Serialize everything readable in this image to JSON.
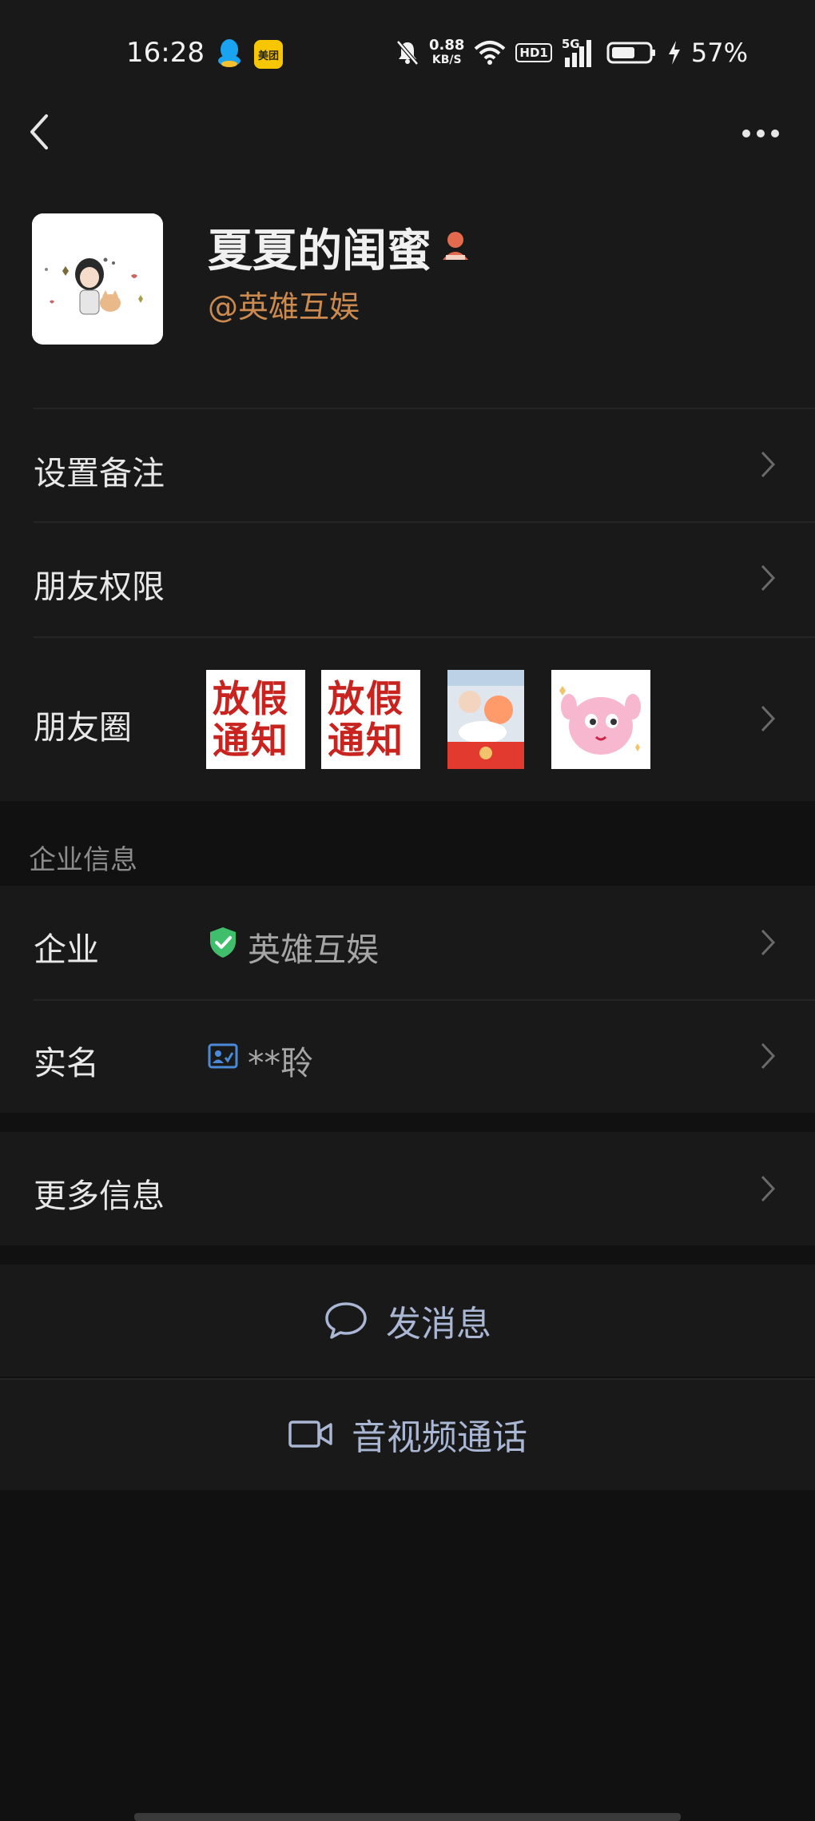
{
  "status_bar": {
    "time": "16:28",
    "net_speed_value": "0.88",
    "net_speed_unit": "KB/S",
    "hd_label": "HD1",
    "signal_label": "5G",
    "battery_percent": "57%",
    "icons": [
      "qq-icon",
      "meituan-icon",
      "mute-bell-icon",
      "wifi-icon",
      "signal-icon",
      "battery-icon",
      "charging-icon"
    ],
    "meituan_label": "美团"
  },
  "nav": {
    "back_icon": "chevron-left-icon",
    "more_icon": "more-horizontal-icon"
  },
  "profile": {
    "name": "夏夏的闺蜜",
    "badge_icon": "person-badge-icon",
    "company_tag": "@英雄互娱"
  },
  "rows": {
    "remark": {
      "label": "设置备注"
    },
    "permissions": {
      "label": "朋友权限"
    },
    "moments": {
      "label": "朋友圈",
      "thumbnails": [
        {
          "text": "放假通知"
        },
        {
          "text": "放假通知"
        },
        {
          "text": ""
        },
        {
          "text": ""
        }
      ]
    }
  },
  "enterprise_section": {
    "title": "企业信息",
    "company": {
      "label": "企业",
      "value": "英雄互娱",
      "icon": "verified-shield-icon"
    },
    "realname": {
      "label": "实名",
      "value": "**聆",
      "icon": "id-card-icon"
    }
  },
  "more_info": {
    "label": "更多信息"
  },
  "actions": {
    "message": {
      "label": "发消息",
      "icon": "chat-bubble-icon"
    },
    "call": {
      "label": "音视频通话",
      "icon": "video-camera-icon"
    }
  },
  "colors": {
    "background": "#111111",
    "card": "#191919",
    "accent_orange": "#cc8a4e",
    "action_text": "#a9b6d4",
    "verified_green": "#3fbf6c",
    "id_blue": "#4a8ad8"
  }
}
